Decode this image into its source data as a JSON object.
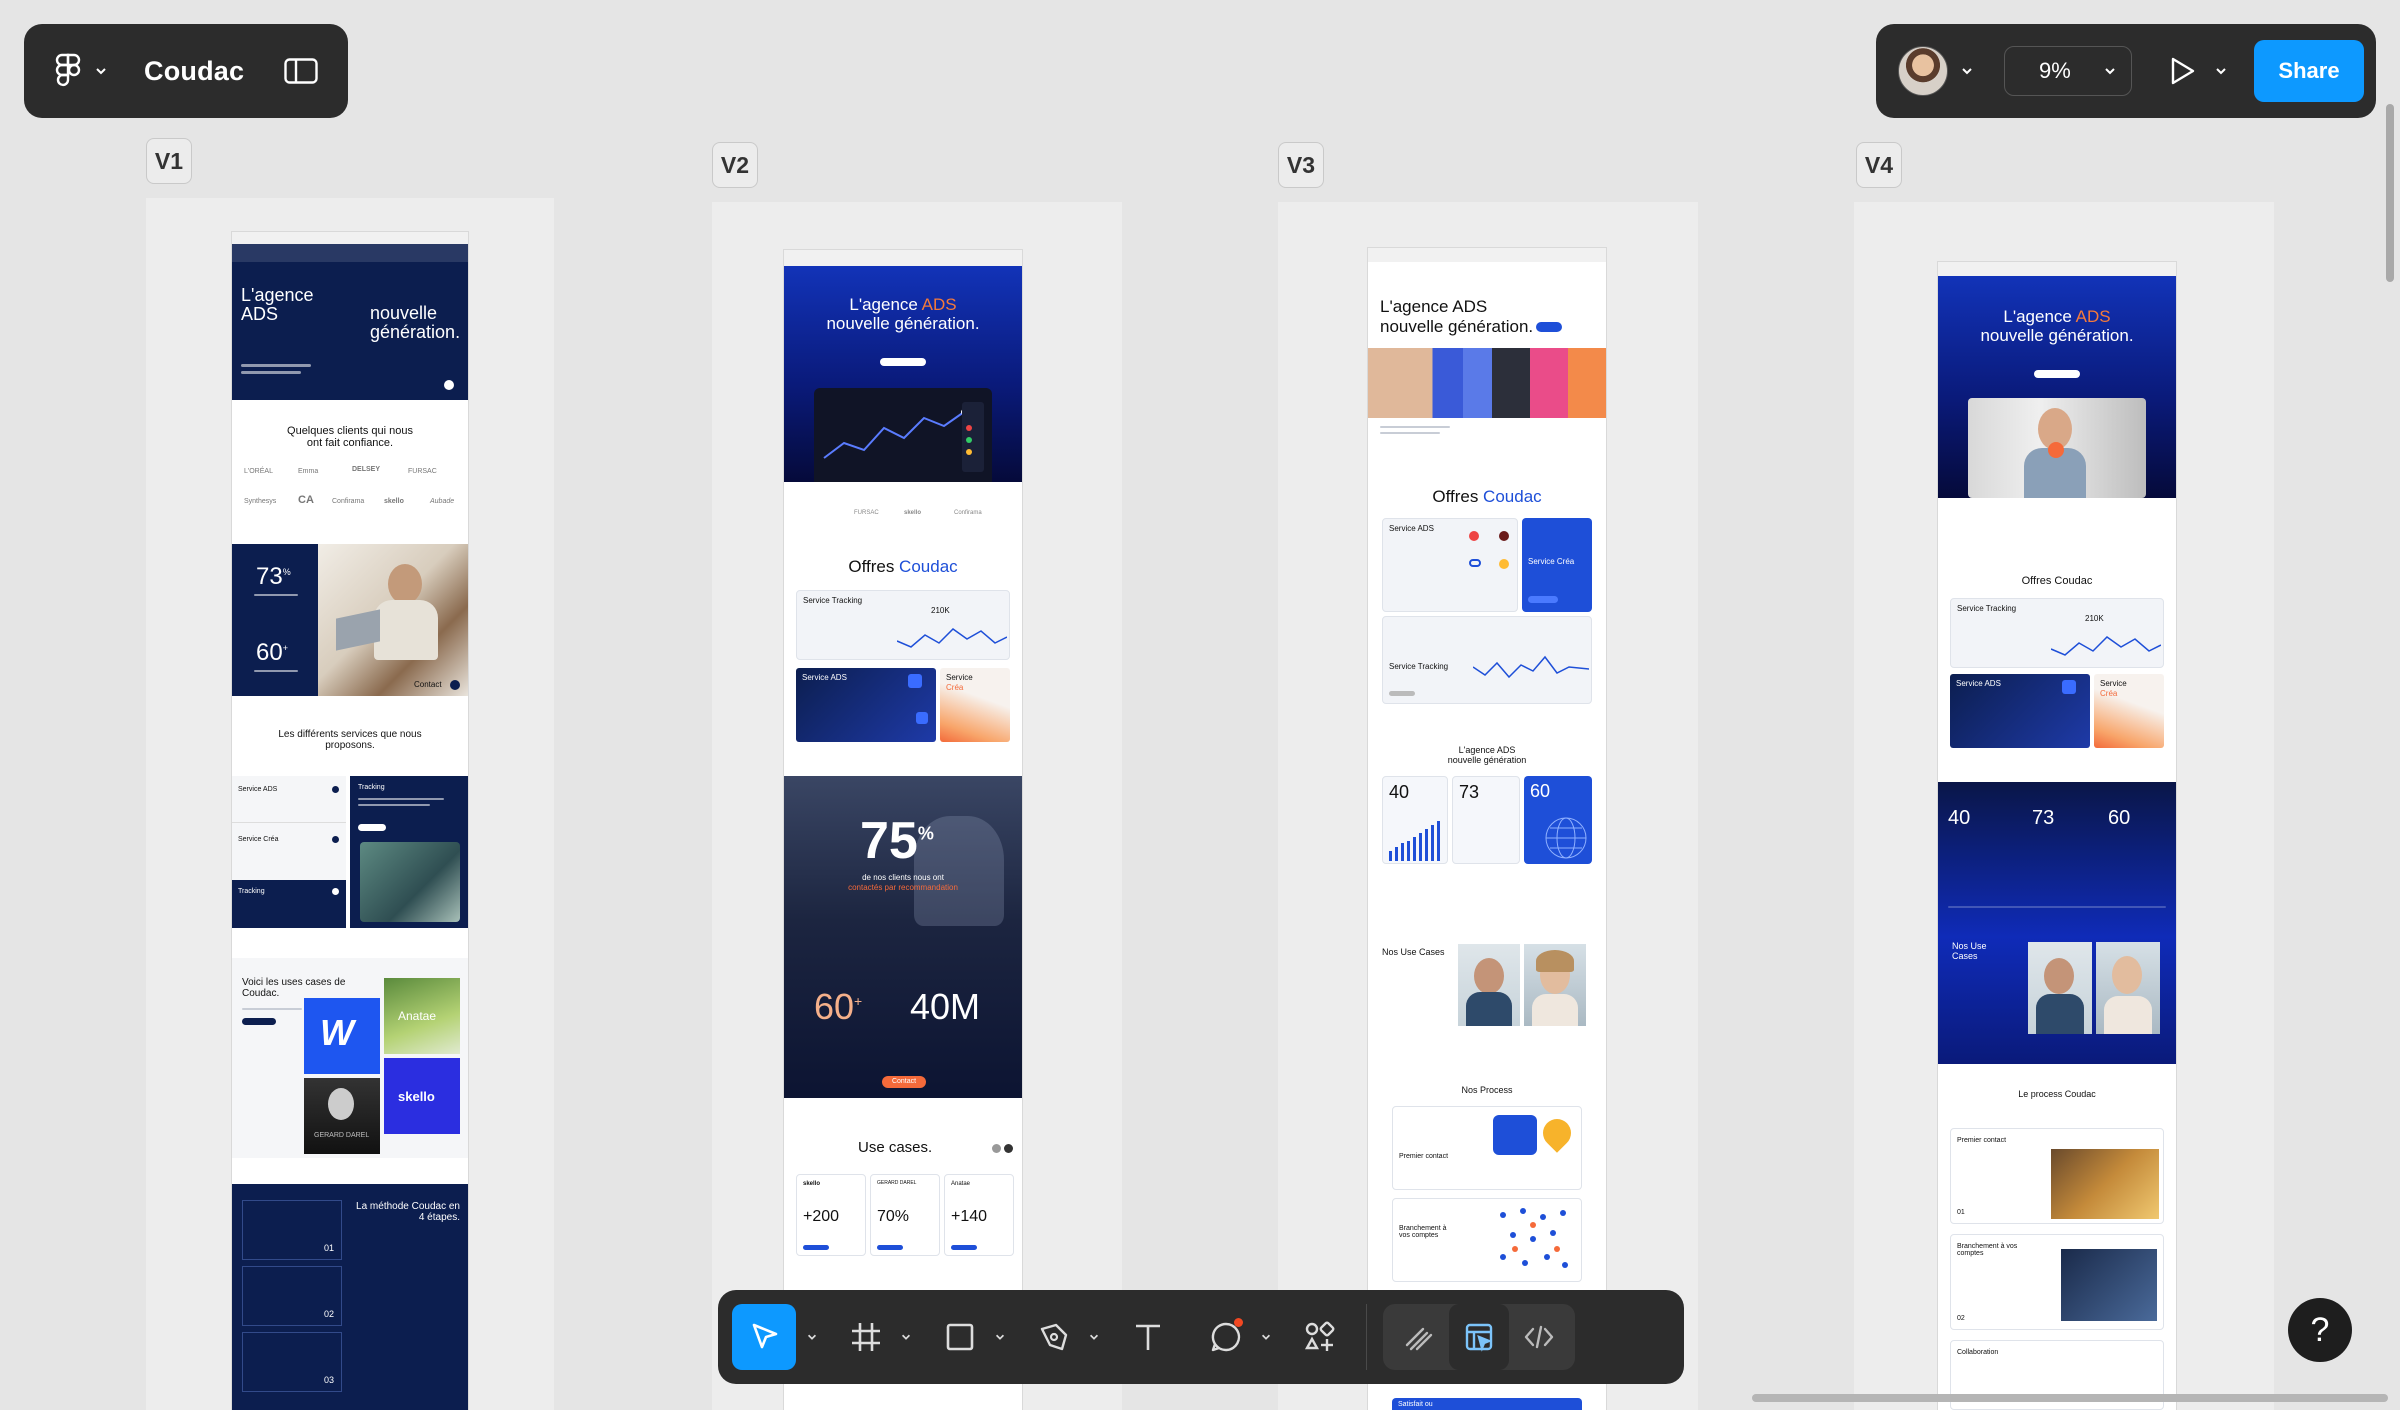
{
  "file": {
    "title": "Coudac"
  },
  "toolbar_right": {
    "zoom": "9%",
    "share_label": "Share"
  },
  "frames": [
    {
      "label": "V1"
    },
    {
      "label": "V2"
    },
    {
      "label": "V3"
    },
    {
      "label": "V4"
    }
  ],
  "v1": {
    "hero_line1": "L'agence",
    "hero_line2": "ADS",
    "hero_line3": "nouvelle",
    "hero_line4": "génération.",
    "clients_title": "Quelques clients qui nous ont fait confiance.",
    "logos": [
      "L'ORÉAL",
      "Emma",
      "DELSEY",
      "FURSAC",
      "Synthesys",
      "CA",
      "Confirama",
      "skello",
      "Aubade"
    ],
    "stat1": "73",
    "stat1_sup": "%",
    "stat2": "60",
    "stat2_sup": "+",
    "contact": "Contact",
    "services_title": "Les différents services que nous proposons.",
    "services": [
      "Service ADS",
      "Service Créa",
      "Tracking"
    ],
    "tracking_label": "Tracking",
    "usecases_title": "Voici les uses cases de Coudac.",
    "anatae": "Anatae",
    "skello": "skello",
    "gerard": "GERARD DAREL",
    "method_title": "La méthode Coudac en 4 étapes.",
    "steps": [
      "01",
      "02",
      "03"
    ]
  },
  "v2": {
    "hero_a": "L'agence ",
    "hero_ads": "ADS",
    "hero_b": "nouvelle génération.",
    "offers_a": "Offres ",
    "offers_b": "Coudac",
    "tracking": "Service Tracking",
    "tracking_val": "210K",
    "ads": "Service ADS",
    "crea_a": "Service",
    "crea_b": "Créa",
    "stat_big": "75",
    "stat_big_sup": "%",
    "stat_caption_a": "de nos clients nous ont",
    "stat_caption_b": "contactés par recommandation",
    "stat_60": "60",
    "stat_60_sup": "+",
    "stat_40m": "40M",
    "contact": "Contact",
    "usecases": "Use cases.",
    "cases": [
      {
        "brand": "skello",
        "value": "+200"
      },
      {
        "brand": "GERARD DAREL",
        "value": "70%"
      },
      {
        "brand": "Anatae",
        "value": "+140"
      }
    ],
    "logos": [
      "FURSAC",
      "skello",
      "Confirama"
    ]
  },
  "v3": {
    "hero_a": "L'agence ADS",
    "hero_b": "nouvelle génération.",
    "offers_a": "Offres ",
    "offers_b": "Coudac",
    "ads": "Service ADS",
    "crea": "Service Créa",
    "tracking": "Service Tracking",
    "agency_a": "L'agence ADS",
    "agency_b": "nouvelle génération",
    "s40": "40",
    "s73": "73",
    "s60": "60",
    "usecases": "Nos Use Cases",
    "process": "Nos Process",
    "p1": "Premier contact",
    "p2": "Branchement à vos comptes",
    "satisfait": "Satisfait ou"
  },
  "v4": {
    "hero_a": "L'agence ",
    "hero_ads": "ADS",
    "hero_b": "nouvelle génération.",
    "offers": "Offres Coudac",
    "tracking": "Service Tracking",
    "tracking_val": "210K",
    "ads": "Service ADS",
    "crea_a": "Service",
    "crea_b": "Créa",
    "s40": "40",
    "s73": "73",
    "s60": "60",
    "usecases_a": "Nos Use",
    "usecases_b": "Cases",
    "process": "Le process Coudac",
    "p1": "Premier contact",
    "p1_num": "01",
    "p2": "Branchement à vos comptes",
    "p2_num": "02",
    "collab": "Collaboration"
  },
  "icons": {
    "figma": "figma-logo-icon",
    "panel": "sidebar-toggle-icon",
    "present": "play-icon",
    "move": "move-arrow-icon",
    "frame": "frame-hash-icon",
    "rect": "rectangle-icon",
    "pen": "pen-icon",
    "text": "text-icon",
    "comment": "comment-icon",
    "assets": "assets-icon",
    "draw": "draw-icon",
    "design": "design-mode-icon",
    "dev": "dev-mode-icon",
    "help": "help-icon"
  },
  "help_label": "?",
  "colors": {
    "accent": "#0d99ff",
    "toolbar": "#2c2c2c",
    "canvas": "#e5e5e5",
    "navy": "#0c1e4f",
    "brand_blue": "#1e4fd8",
    "orange": "#f56a3a"
  }
}
